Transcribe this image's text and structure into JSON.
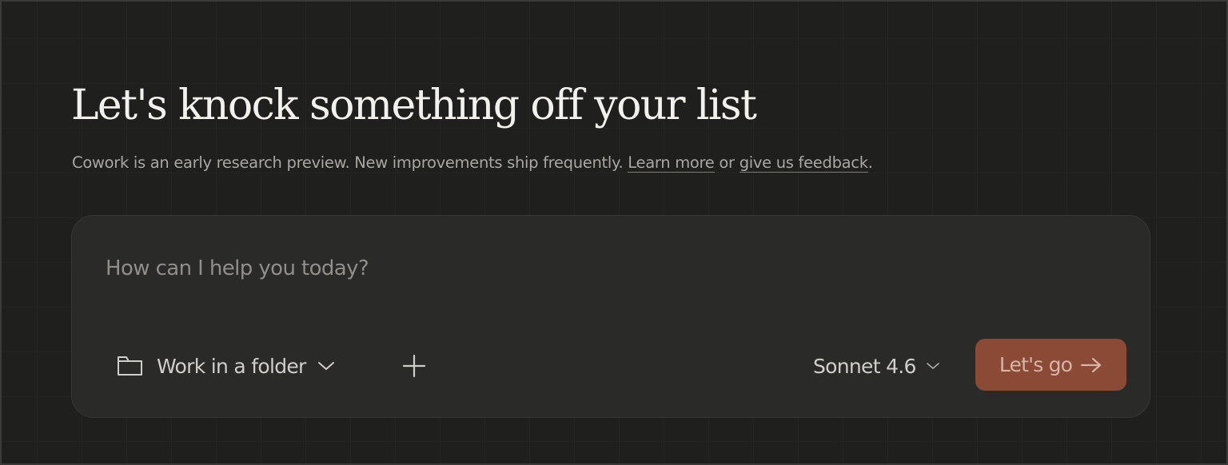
{
  "header": {
    "title": "Let's knock something off your list",
    "subtitle_text": "Cowork is an early research preview. New improvements ship frequently.",
    "learn_more_link": "Learn more",
    "or_text": "or",
    "feedback_link": "give us feedback",
    "period": "."
  },
  "composer": {
    "placeholder": "How can I help you today?",
    "folder_button_label": "Work in a folder",
    "folder_icon": "folder-icon",
    "add_icon": "plus-icon",
    "model_label": "Sonnet 4.6",
    "submit_label": "Let's go",
    "submit_icon": "arrow-right-icon"
  },
  "colors": {
    "background": "#1f1f1e",
    "composer_background": "#2a2a29",
    "accent": "#8a4a36",
    "accent_text": "#d8b3a6"
  }
}
